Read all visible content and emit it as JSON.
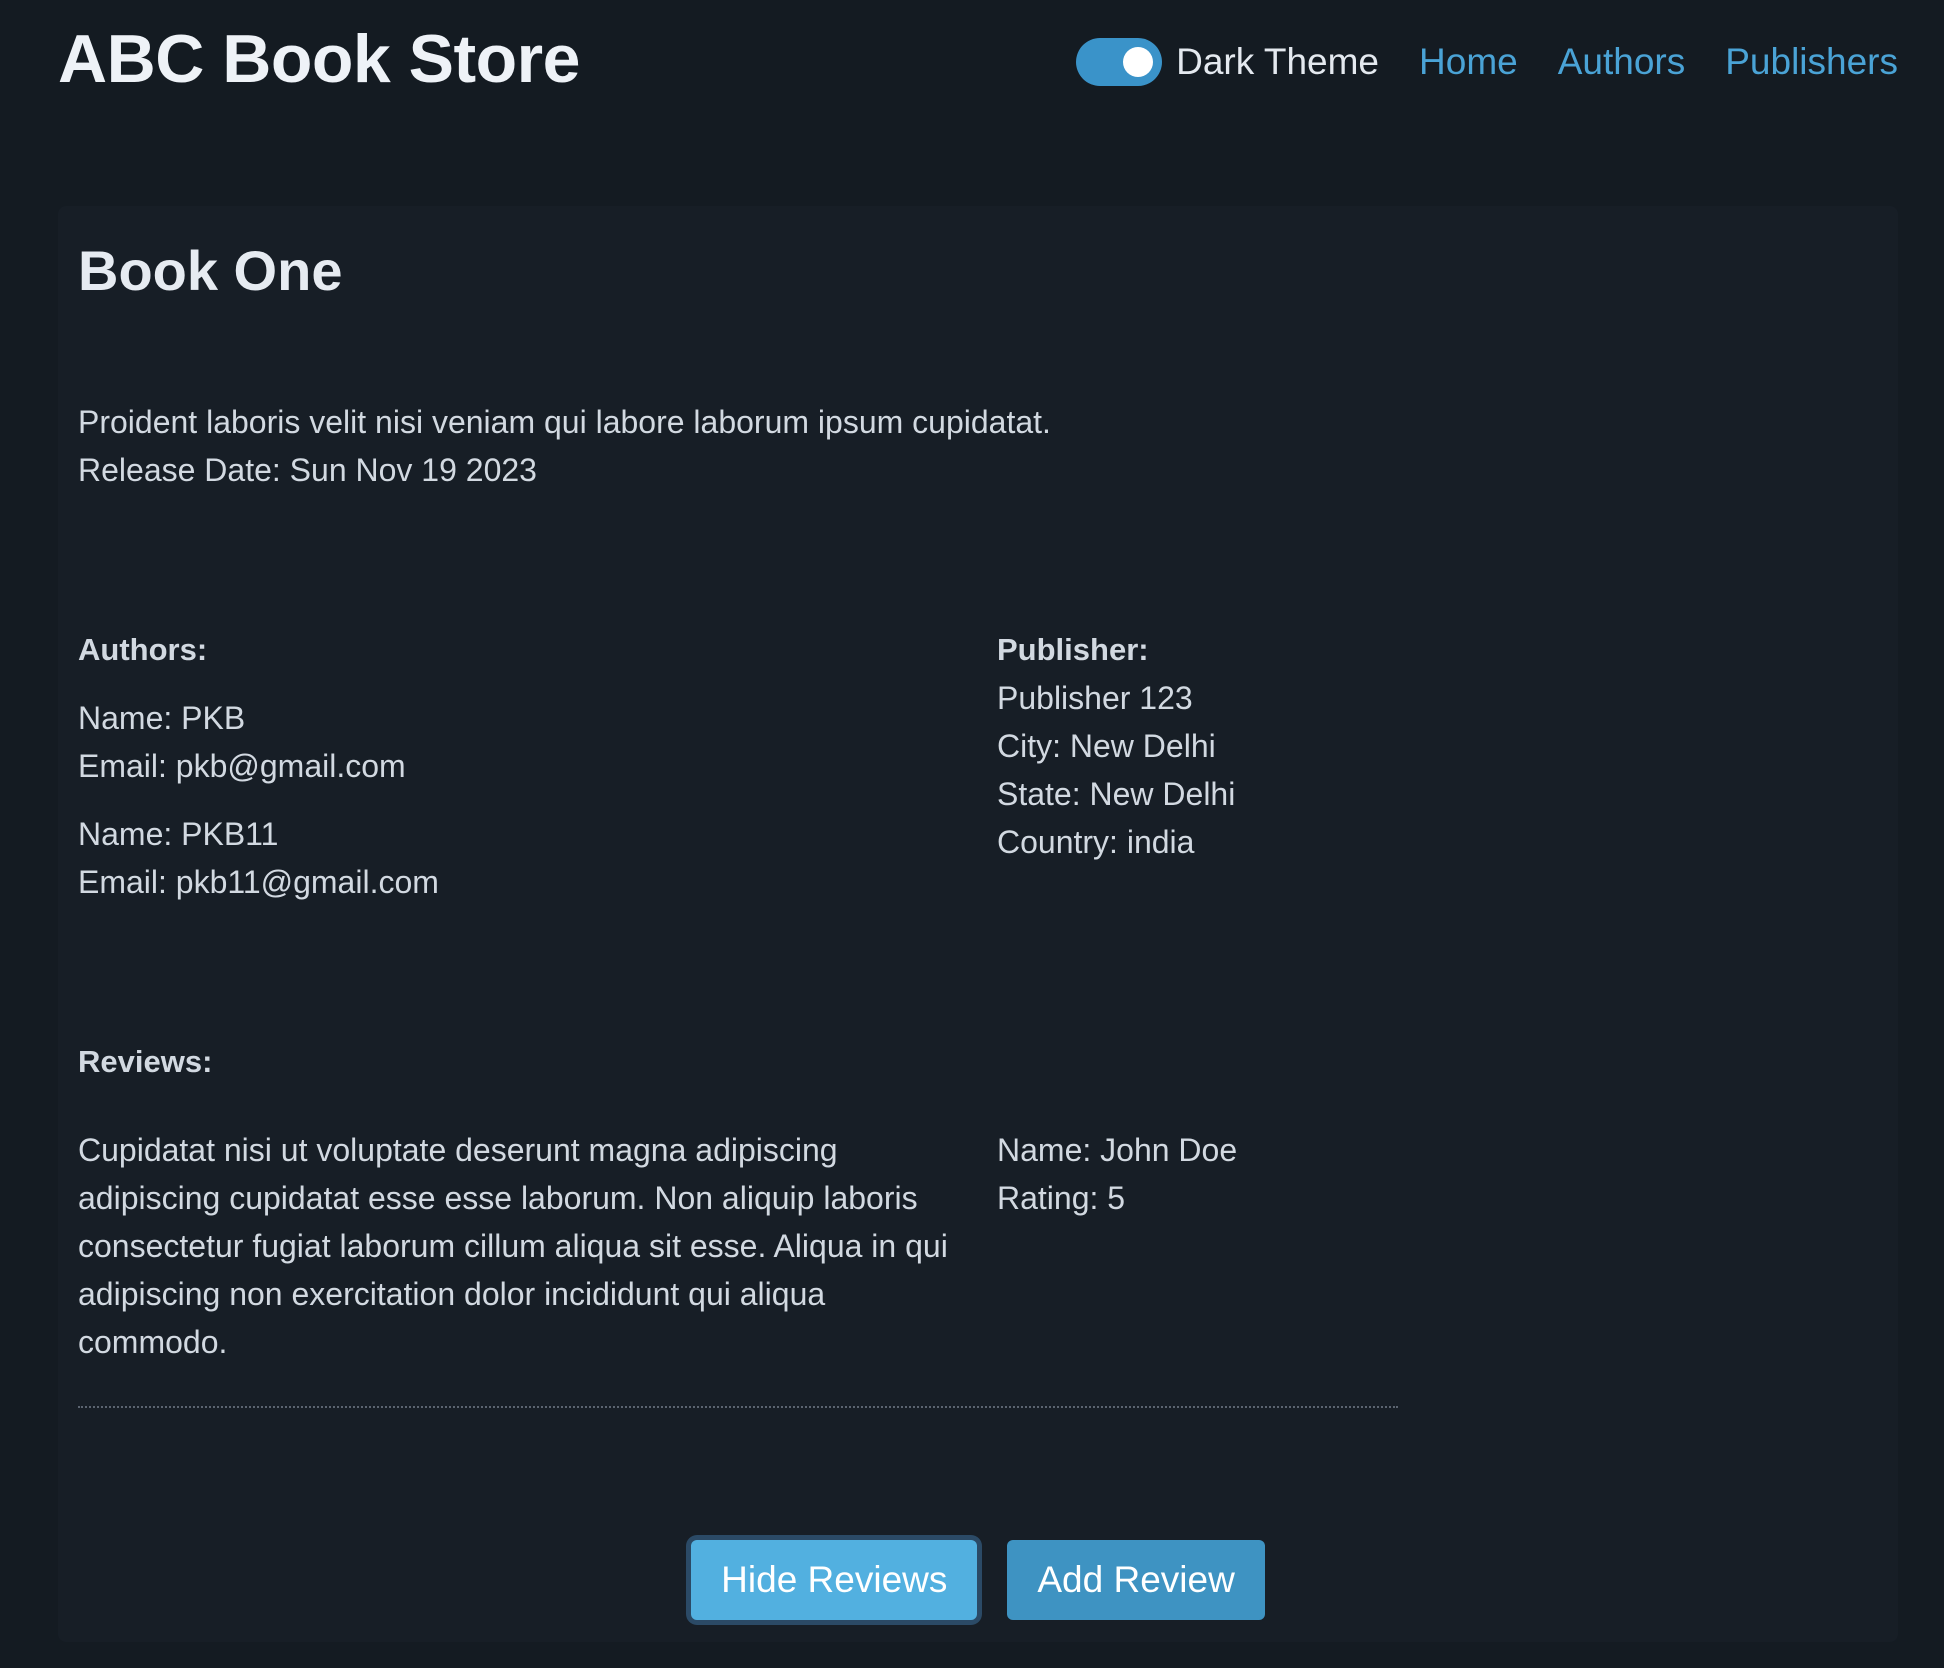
{
  "header": {
    "brand": "ABC Book Store",
    "theme_toggle": {
      "label": "Dark Theme",
      "checked": true
    },
    "nav": [
      {
        "label": "Home"
      },
      {
        "label": "Authors"
      },
      {
        "label": "Publishers"
      }
    ]
  },
  "book": {
    "title": "Book One",
    "description": "Proident laboris velit nisi veniam qui labore laborum ipsum cupidatat.",
    "release_date": "Release Date: Sun Nov 19 2023",
    "authors_label": "Authors:",
    "authors": [
      {
        "name": "Name: PKB",
        "email": "Email: pkb@gmail.com"
      },
      {
        "name": "Name: PKB11",
        "email": "Email: pkb11@gmail.com"
      }
    ],
    "publisher": {
      "label": "Publisher:",
      "name": "Publisher 123",
      "city": "City: New Delhi",
      "state": "State: New Delhi",
      "country": "Country: india"
    },
    "reviews_label": "Reviews:",
    "reviews": [
      {
        "text": "Cupidatat nisi ut voluptate deserunt magna adipiscing adipiscing cupidatat esse esse laborum. Non aliquip laboris consectetur fugiat laborum cillum aliqua sit esse. Aliqua in qui adipiscing non exercitation dolor incididunt qui aliqua commodo.",
        "name": "Name: John Doe",
        "rating": "Rating: 5"
      }
    ]
  },
  "actions": {
    "hide_reviews": "Hide Reviews",
    "add_review": "Add Review"
  },
  "colors": {
    "background": "#141b22",
    "card": "#171e26",
    "accent": "#4aa3d6",
    "toggle": "#3a93c9",
    "button_primary": "#52b0e0",
    "button_secondary": "#3e93c2"
  }
}
